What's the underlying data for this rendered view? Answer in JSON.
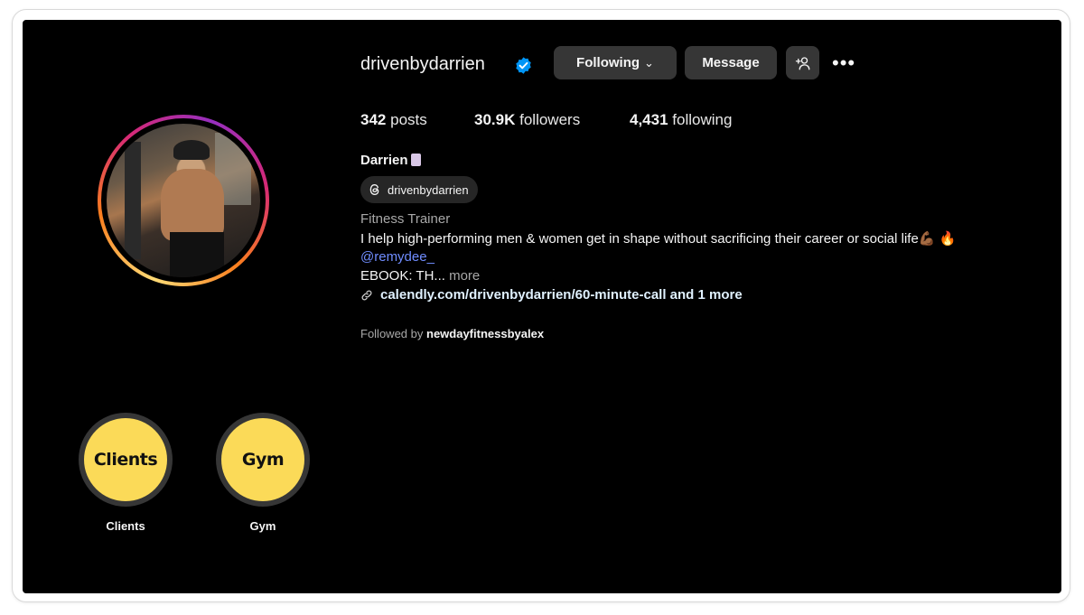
{
  "profile": {
    "username": "drivenbydarrien",
    "verified": true,
    "full_name": "Darrien",
    "threads_handle": "drivenbydarrien",
    "category": "Fitness Trainer",
    "bio_line": "I help high-performing men & women get in shape without sacrificing their career or social life💪🏾 🔥",
    "mention": "@remydee_",
    "ebook_text": "EBOOK: TH...",
    "ebook_more": "more",
    "link": "calendly.com/drivenbydarrien/60-minute-call and 1 more",
    "followed_by_prefix": "Followed by",
    "followed_by_user": "newdayfitnessbyalex"
  },
  "actions": {
    "following_label": "Following",
    "message_label": "Message",
    "more_label": "•••"
  },
  "stats": {
    "posts_count": "342",
    "posts_label": "posts",
    "followers_count": "30.9K",
    "followers_label": "followers",
    "following_count": "4,431",
    "following_label": "following"
  },
  "highlights": [
    {
      "cover_text": "Clients",
      "label": "Clients",
      "color": "#fbda58"
    },
    {
      "cover_text": "Gym",
      "label": "Gym",
      "color": "#fbda58"
    }
  ],
  "colors": {
    "background": "#000000",
    "button": "#363636",
    "verified": "#0095f6",
    "mention": "#708dff"
  },
  "icons": [
    "verified-badge-icon",
    "chevron-down-icon",
    "add-user-icon",
    "more-options-icon",
    "threads-icon",
    "link-icon"
  ]
}
